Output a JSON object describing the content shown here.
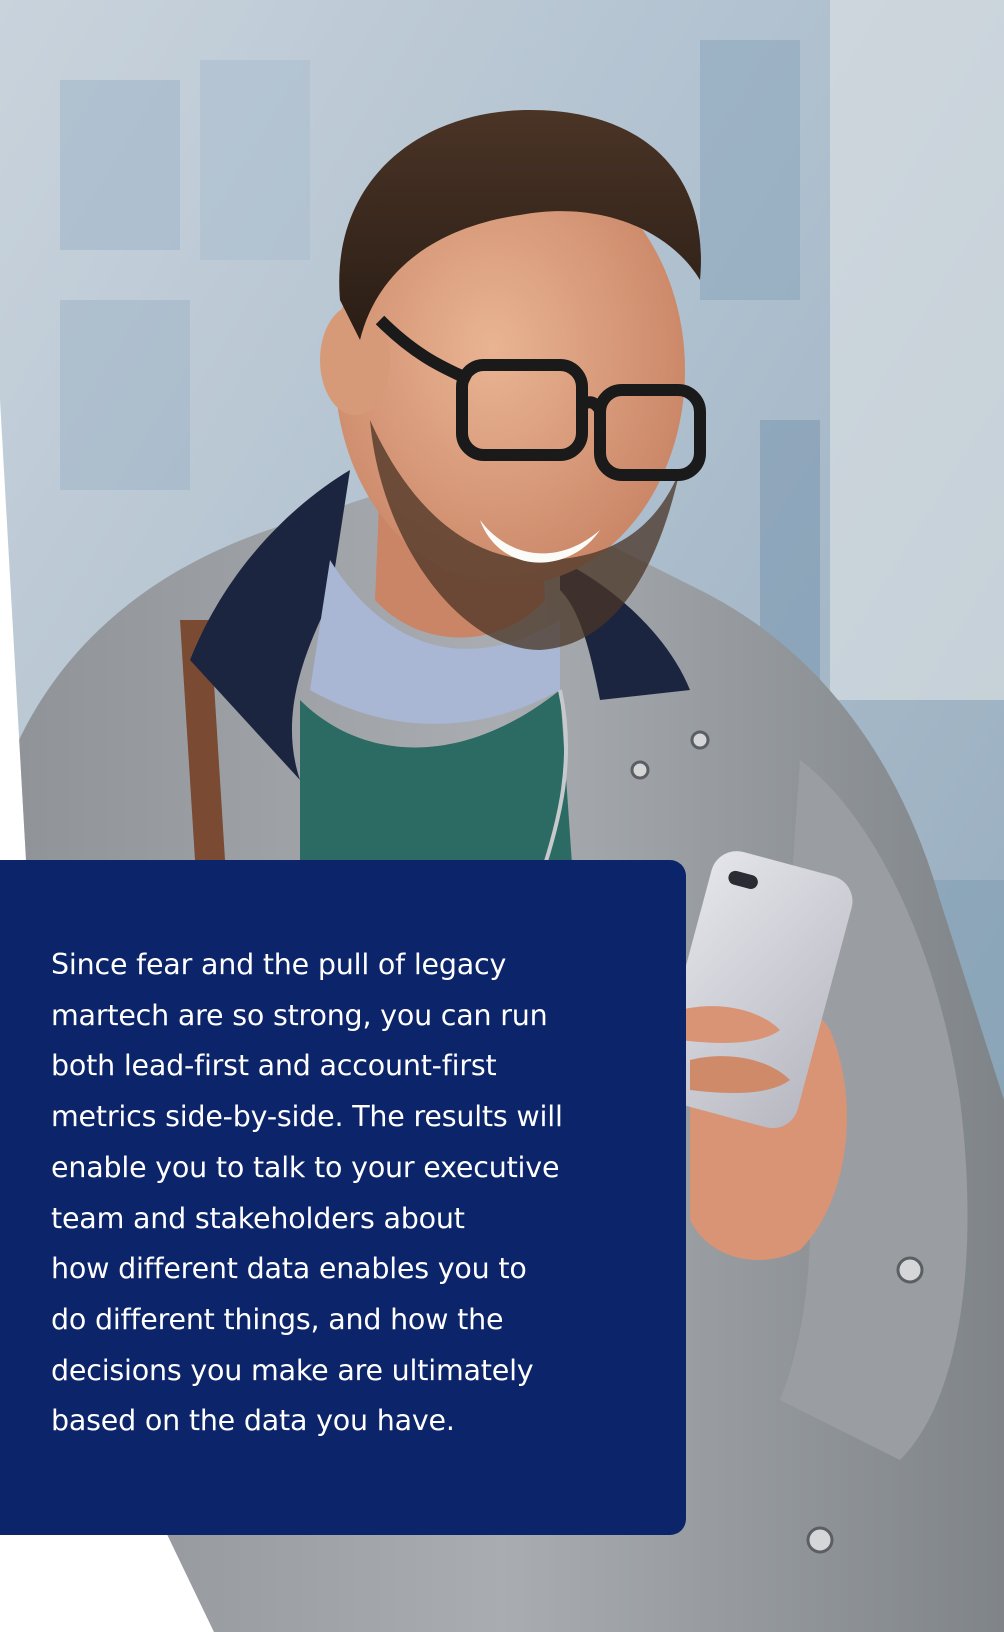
{
  "quote": {
    "text": "Since fear and the pull of legacy\nmartech are so strong, you can run\nboth lead-first and account-first\nmetrics side-by-side. The results will\nenable you to talk to your executive\nteam and stakeholders about\nhow different data enables you to\ndo different things, and how the\ndecisions you make are ultimately\nbased on the data you have."
  },
  "colors": {
    "panel_background": "#0c246a",
    "panel_text": "#ffffff",
    "page_background": "#ffffff"
  },
  "image": {
    "subject": "smiling man with glasses looking at smartphone"
  }
}
